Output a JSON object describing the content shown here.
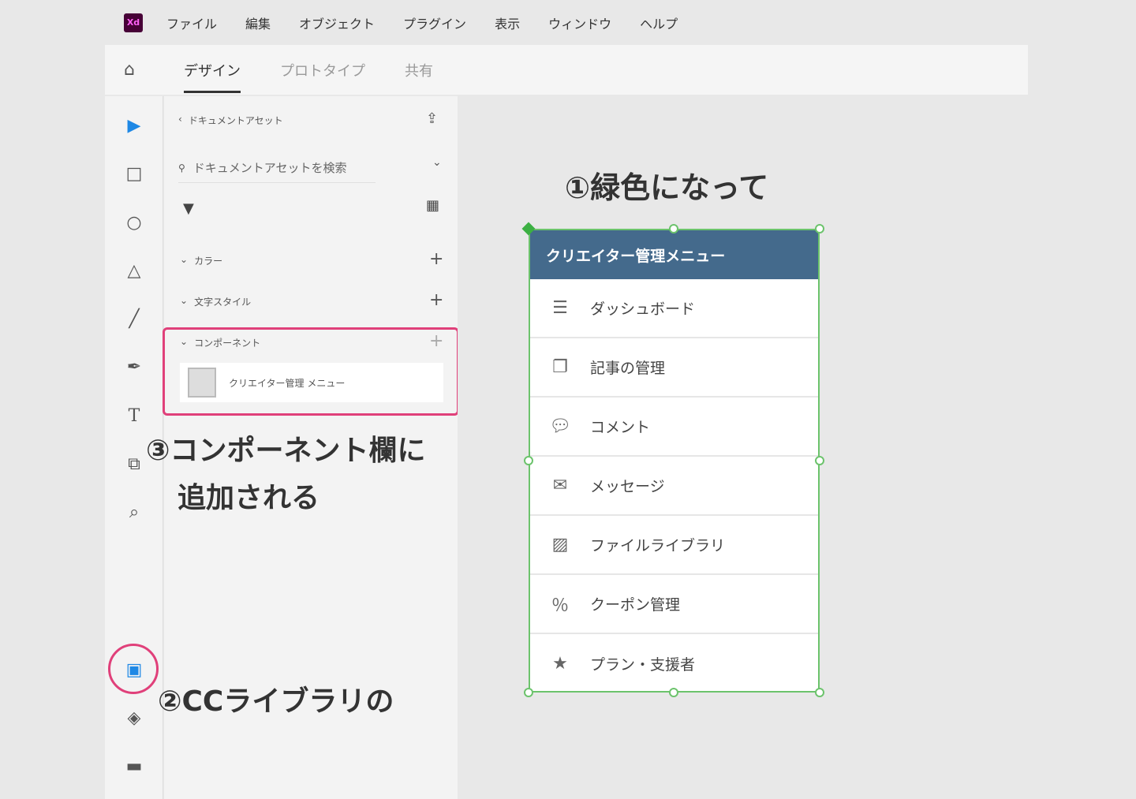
{
  "menubar": {
    "logo": "Xd",
    "items": [
      "ファイル",
      "編集",
      "オブジェクト",
      "プラグイン",
      "表示",
      "ウィンドウ",
      "ヘルプ"
    ]
  },
  "tabs": [
    "デザイン",
    "プロトタイプ",
    "共有"
  ],
  "panel": {
    "back_label": "ドキュメントアセット",
    "search_placeholder": "ドキュメントアセットを検索",
    "sections": [
      "カラー",
      "文字スタイル",
      "コンポーネント"
    ],
    "component_item": "クリエイター管理 メニュー"
  },
  "card": {
    "title": "クリエイター管理メニュー",
    "items": [
      "ダッシュボード",
      "記事の管理",
      "コメント",
      "メッセージ",
      "ファイルライブラリ",
      "クーポン管理",
      "プラン・支援者"
    ]
  },
  "annotations": {
    "a1": "①緑色になって",
    "a2": "②CCライブラリの",
    "a3_line1": "③コンポーネント欄に",
    "a3_line2": "追加される"
  },
  "colors": {
    "accent": "#e0407a",
    "selection": "#6cc36c",
    "header": "#446a8c"
  }
}
